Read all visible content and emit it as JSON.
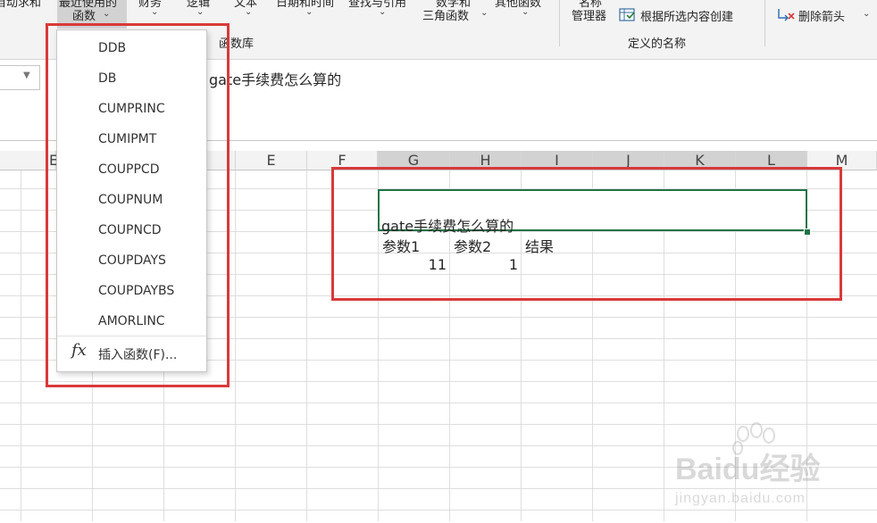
{
  "ribbon": {
    "partial_labels": [
      "自动求和",
      "最近使用的",
      "财务",
      "逻辑",
      "文本",
      "日期和时间",
      "查找与引用",
      "数学和",
      "其他函数"
    ],
    "recent_functions_label": "函数",
    "math_trig_label": "三角函数",
    "name_manager_label": "管理器",
    "name_manager_top": "名称",
    "create_from_selection_label": "根据所选内容创建",
    "remove_arrows_label": "删除箭头",
    "group_function_library": "函数库",
    "group_defined_names": "定义的名称"
  },
  "formula_bar": {
    "content": "gate手续费怎么算的"
  },
  "columns": [
    "E",
    "F",
    "G",
    "H",
    "I",
    "J",
    "K",
    "L",
    "M"
  ],
  "partial_column": "E",
  "cells": {
    "title": "gate手续费怎么算的",
    "header_param1": "参数1",
    "header_param2": "参数2",
    "header_result": "结果",
    "param1_value": "11",
    "param2_value": "1"
  },
  "dropdown": {
    "items": [
      "DDB",
      "DB",
      "CUMPRINC",
      "CUMIPMT",
      "COUPPCD",
      "COUPNUM",
      "COUPNCD",
      "COUPDAYS",
      "COUPDAYBS",
      "AMORLINC"
    ],
    "insert_function_label": "插入函数(F)...",
    "fx_glyph": "fx"
  },
  "watermark": {
    "brand": "Baidu经验",
    "url": "jingyan.baidu.com"
  },
  "colors": {
    "highlight_red": "#d9393a",
    "active_cell_green": "#217346",
    "ribbon_bg": "#f3f3f3"
  }
}
